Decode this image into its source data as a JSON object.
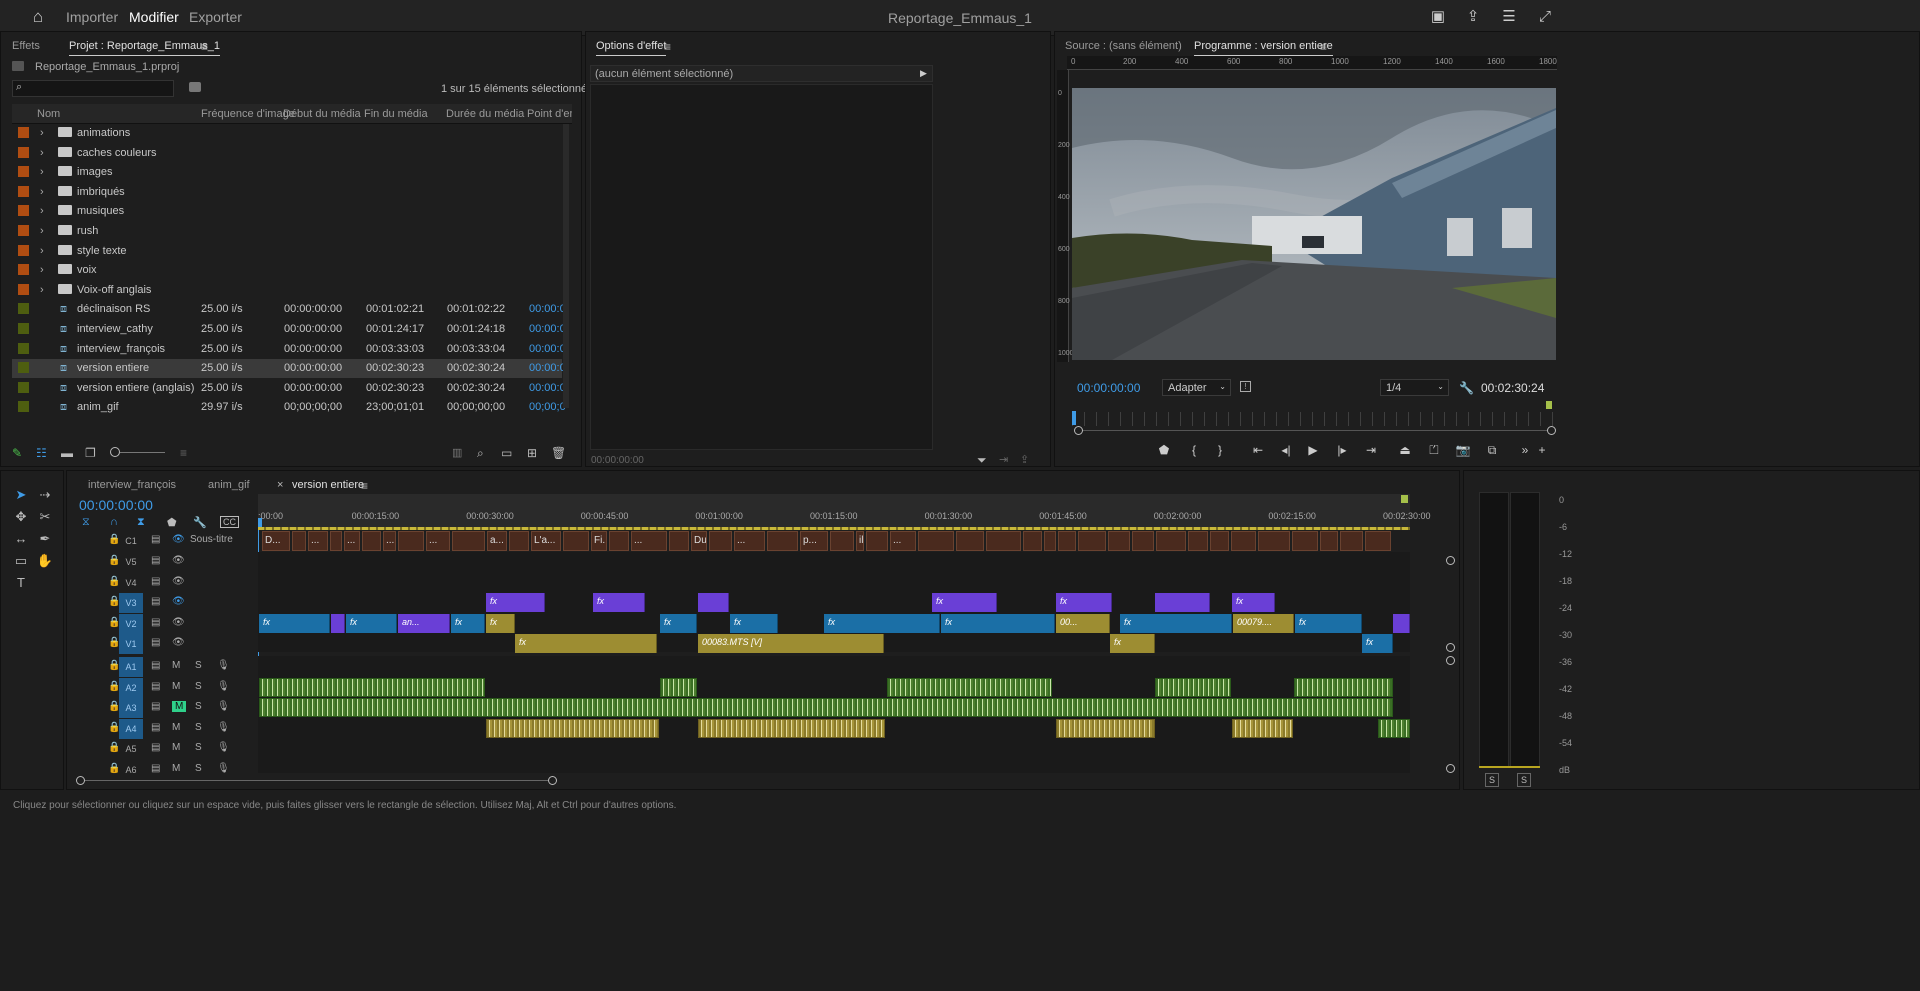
{
  "topbar": {
    "home": "home-icon",
    "tabs": [
      "Importer",
      "Modifier",
      "Exporter"
    ],
    "active_tab": "Modifier",
    "title": "Reportage_Emmaus_1"
  },
  "project_panel": {
    "tabs": [
      "Effets",
      "Projet : Reportage_Emmaus_1"
    ],
    "file": "Reportage_Emmaus_1.prproj",
    "selection": "1 sur 15 éléments sélectionné(s)",
    "columns": [
      "Nom",
      "Fréquence d'image",
      "Début du média",
      "Fin du média",
      "Durée du média",
      "Point d'ent"
    ],
    "rows": [
      {
        "name": "animations",
        "type": "folder",
        "color": "#b04d12"
      },
      {
        "name": "caches couleurs",
        "type": "folder",
        "color": "#b04d12"
      },
      {
        "name": "images",
        "type": "folder",
        "color": "#b04d12"
      },
      {
        "name": "imbriqués",
        "type": "folder",
        "color": "#b04d12"
      },
      {
        "name": "musiques",
        "type": "folder",
        "color": "#b04d12"
      },
      {
        "name": "rush",
        "type": "folder",
        "color": "#b04d12"
      },
      {
        "name": "style texte",
        "type": "folder",
        "color": "#b04d12"
      },
      {
        "name": "voix",
        "type": "folder",
        "color": "#b04d12"
      },
      {
        "name": "Voix-off anglais",
        "type": "folder",
        "color": "#b04d12"
      },
      {
        "name": "déclinaison RS",
        "type": "seq",
        "color": "#4e5e10",
        "fps": "25.00 i/s",
        "start": "00:00:00:00",
        "end": "00:01:02:21",
        "dur": "00:01:02:22",
        "in": "00:00:0"
      },
      {
        "name": "interview_cathy",
        "type": "seq",
        "color": "#4e5e10",
        "fps": "25.00 i/s",
        "start": "00:00:00:00",
        "end": "00:01:24:17",
        "dur": "00:01:24:18",
        "in": "00:00:0"
      },
      {
        "name": "interview_françois",
        "type": "seq",
        "color": "#4e5e10",
        "fps": "25.00 i/s",
        "start": "00:00:00:00",
        "end": "00:03:33:03",
        "dur": "00:03:33:04",
        "in": "00:00:0"
      },
      {
        "name": "version entiere",
        "type": "seq",
        "color": "#4e5e10",
        "fps": "25.00 i/s",
        "start": "00:00:00:00",
        "end": "00:02:30:23",
        "dur": "00:02:30:24",
        "in": "00:00:0",
        "selected": true
      },
      {
        "name": "version entiere (anglais)",
        "type": "seq",
        "color": "#4e5e10",
        "fps": "25.00 i/s",
        "start": "00:00:00:00",
        "end": "00:02:30:23",
        "dur": "00:02:30:24",
        "in": "00:00:0"
      },
      {
        "name": "anim_gif",
        "type": "seq",
        "color": "#4e5e10",
        "fps": "29.97 i/s",
        "start": "00;00;00;00",
        "end": "23;00;01;01",
        "dur": "00;00;00;00",
        "in": "00;00;0"
      }
    ]
  },
  "effect_options": {
    "tab": "Options d'effet",
    "empty": "(aucun élément sélectionné)",
    "timecode": "00:00:00:00"
  },
  "program_monitor": {
    "tabs": [
      "Source : (sans élément)",
      "Programme : version entiere"
    ],
    "ruler": [
      "0",
      "200",
      "400",
      "600",
      "800",
      "1000",
      "1200",
      "1400",
      "1600",
      "1800"
    ],
    "vruler": [
      "0",
      "200",
      "400",
      "600",
      "800",
      "1000"
    ],
    "timecode": "00:00:00:00",
    "fit": "Adapter",
    "quality": "1/4",
    "duration": "00:02:30:24"
  },
  "timeline": {
    "tabs": [
      "interview_françois",
      "anim_gif",
      "version entiere"
    ],
    "timecode": "00:00:00:00",
    "ruler": [
      ":00:00",
      "00:00:15:00",
      "00:00:30:00",
      "00:00:45:00",
      "00:01:00:00",
      "00:01:15:00",
      "00:01:30:00",
      "00:01:45:00",
      "00:02:00:00",
      "00:02:15:00",
      "00:02:30:00"
    ],
    "caption_track": {
      "label": "C1",
      "name": "Sous-titre"
    },
    "video_tracks": [
      "V5",
      "V4",
      "V3",
      "V2",
      "V1"
    ],
    "audio_tracks": [
      "A1",
      "A2",
      "A3",
      "A4",
      "A5",
      "A6"
    ],
    "captions": [
      "D...",
      "...",
      "...",
      "...",
      "...",
      "a...",
      "L'a...",
      "Fi...",
      "...",
      "Du...",
      "...",
      "p...",
      "il...",
      "...",
      "où ...",
      "o...",
      "...",
      "car...",
      "...",
      "Cet...",
      "...",
      "pe...",
      "q...",
      "Ce...",
      "...",
      "ça ...",
      "À ..."
    ],
    "clip_labels": {
      "fx": "fx",
      "an": "an...",
      "mts": "00083.MTS [V]",
      "c60": "00...",
      "c79": "00079...."
    },
    "mute": "M",
    "solo": "S"
  },
  "meters": {
    "scale": [
      "0",
      "-6",
      "-12",
      "-18",
      "-24",
      "-30",
      "-36",
      "-42",
      "-48",
      "-54",
      "dB"
    ],
    "solo": "S"
  },
  "statusbar": {
    "text": "Cliquez pour sélectionner ou cliquez sur un espace vide, puis faites glisser vers le rectangle de sélection. Utilisez Maj, Alt et Ctrl pour d'autres options."
  }
}
